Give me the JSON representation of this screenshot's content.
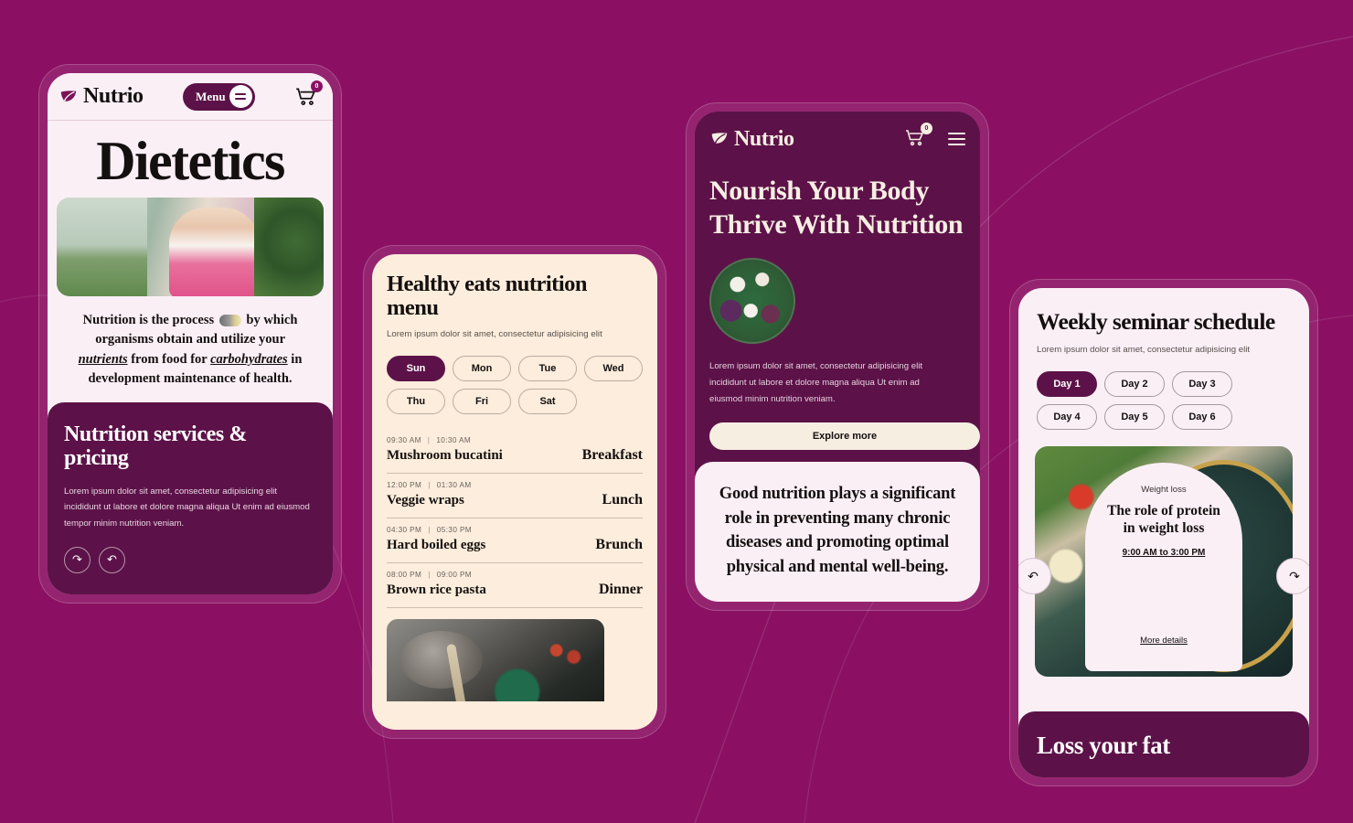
{
  "background": {
    "color": "#8B1063"
  },
  "brand": {
    "name": "Nutrio",
    "logo_icon": "leaf-sprout-icon"
  },
  "phone1": {
    "header": {
      "menu_label": "Menu",
      "menu_icon": "hamburger-icon",
      "cart_icon": "shopping-cart-icon",
      "cart_count": "0"
    },
    "title": "Dietetics",
    "media": {
      "play_icon": "play-icon",
      "alt": "woman in kitchen with vegetables"
    },
    "body_parts": {
      "p1": "Nutrition is the process",
      "p2": "by which organisms obtain and utilize your",
      "link1": "nutrients",
      "p3": "from food for",
      "link2": "carbohydrates",
      "p4": "in development maintenance of health."
    },
    "dark_section": {
      "heading": "Nutrition services & pricing",
      "paragraph": "Lorem ipsum dolor sit amet, consectetur adipisicing elit incididunt ut labore et dolore magna aliqua Ut enim ad eiusmod tempor minim nutrition veniam.",
      "next_icon": "arrow-next-icon",
      "prev_icon": "arrow-prev-icon"
    }
  },
  "phone2": {
    "title": "Healthy eats nutrition menu",
    "subtitle": "Lorem ipsum dolor sit amet, consectetur adipisicing elit",
    "days": [
      {
        "label": "Sun",
        "active": true
      },
      {
        "label": "Mon",
        "active": false
      },
      {
        "label": "Tue",
        "active": false
      },
      {
        "label": "Wed",
        "active": false
      },
      {
        "label": "Thu",
        "active": false
      },
      {
        "label": "Fri",
        "active": false
      },
      {
        "label": "Sat",
        "active": false
      }
    ],
    "meals": [
      {
        "start": "09:30 AM",
        "end": "10:30 AM",
        "name": "Mushroom bucatini",
        "type": "Breakfast"
      },
      {
        "start": "12:00 PM",
        "end": "01:30 AM",
        "name": "Veggie wraps",
        "type": "Lunch"
      },
      {
        "start": "04:30 PM",
        "end": "05:30 PM",
        "name": "Hard boiled eggs",
        "type": "Brunch"
      },
      {
        "start": "08:00 PM",
        "end": "09:00 PM",
        "name": "Brown rice pasta",
        "type": "Dinner"
      }
    ],
    "photo_alt": "vintage cutlery on dark tray with rose petals"
  },
  "phone3": {
    "header": {
      "cart_icon": "shopping-cart-icon",
      "cart_count": "0",
      "menu_icon": "hamburger-icon"
    },
    "title": "Nourish Your Body Thrive With Nutrition",
    "salad_alt": "round salad bowl with greens and cheese",
    "paragraph": "Lorem ipsum dolor sit amet, consectetur adipisicing elit incididunt ut labore et dolore magna aliqua Ut enim ad eiusmod minim nutrition veniam.",
    "cta_label": "Explore more",
    "quote": "Good nutrition plays a significant role in preventing many chronic diseases and promoting optimal physical and mental well-being."
  },
  "phone4": {
    "title": "Weekly seminar schedule",
    "subtitle": "Lorem ipsum dolor sit amet, consectetur adipisicing elit",
    "days": [
      {
        "label": "Day 1",
        "active": true
      },
      {
        "label": "Day 2",
        "active": false
      },
      {
        "label": "Day 3",
        "active": false
      },
      {
        "label": "Day 4",
        "active": false
      },
      {
        "label": "Day 5",
        "active": false
      },
      {
        "label": "Day 6",
        "active": false
      }
    ],
    "card": {
      "tag": "Weight loss",
      "title": "The role of protein in weight loss",
      "time": "9:00 AM to 3:00 PM",
      "more_label": "More details",
      "photo_alt": "salad bowl with eggs peppers and greens"
    },
    "prev_icon": "arrow-prev-icon",
    "next_icon": "arrow-next-icon",
    "footer_heading": "Loss your fat"
  }
}
